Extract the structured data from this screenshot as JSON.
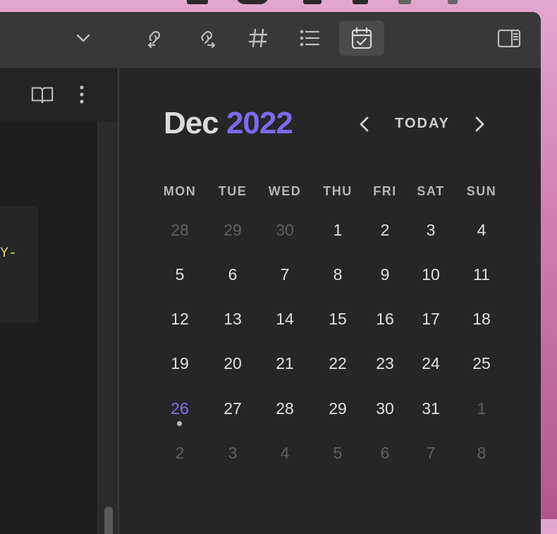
{
  "toolbar": {
    "buttons": [
      {
        "icon": "chevron-down-icon"
      },
      {
        "icon": "backlinks-icon"
      },
      {
        "icon": "outgoing-links-icon"
      },
      {
        "icon": "tags-icon"
      },
      {
        "icon": "outline-icon"
      },
      {
        "icon": "calendar-icon",
        "active": true
      },
      {
        "icon": "toggle-right-sidebar-icon"
      }
    ]
  },
  "left_pane": {
    "code_fragment": "Y-"
  },
  "calendar": {
    "month": "Dec",
    "year": "2022",
    "today_label": "TODAY",
    "weekdays": [
      "MON",
      "TUE",
      "WED",
      "THU",
      "FRI",
      "SAT",
      "SUN"
    ],
    "weeks": [
      [
        {
          "d": "28",
          "m": true
        },
        {
          "d": "29",
          "m": true
        },
        {
          "d": "30",
          "m": true
        },
        {
          "d": "1"
        },
        {
          "d": "2"
        },
        {
          "d": "3"
        },
        {
          "d": "4"
        }
      ],
      [
        {
          "d": "5"
        },
        {
          "d": "6"
        },
        {
          "d": "7"
        },
        {
          "d": "8"
        },
        {
          "d": "9"
        },
        {
          "d": "10"
        },
        {
          "d": "11"
        }
      ],
      [
        {
          "d": "12"
        },
        {
          "d": "13"
        },
        {
          "d": "14"
        },
        {
          "d": "15"
        },
        {
          "d": "16"
        },
        {
          "d": "17"
        },
        {
          "d": "18"
        }
      ],
      [
        {
          "d": "19"
        },
        {
          "d": "20"
        },
        {
          "d": "21"
        },
        {
          "d": "22"
        },
        {
          "d": "23"
        },
        {
          "d": "24"
        },
        {
          "d": "25"
        }
      ],
      [
        {
          "d": "26",
          "today": true,
          "dot": true
        },
        {
          "d": "27"
        },
        {
          "d": "28"
        },
        {
          "d": "29"
        },
        {
          "d": "30"
        },
        {
          "d": "31"
        },
        {
          "d": "1",
          "m": true
        }
      ],
      [
        {
          "d": "2",
          "m": true
        },
        {
          "d": "3",
          "m": true
        },
        {
          "d": "4",
          "m": true
        },
        {
          "d": "5",
          "m": true
        },
        {
          "d": "6",
          "m": true
        },
        {
          "d": "7",
          "m": true
        },
        {
          "d": "8",
          "m": true
        }
      ]
    ]
  },
  "colors": {
    "accent": "#7b6af0",
    "background": "#262626",
    "muted_day": "#606060"
  }
}
